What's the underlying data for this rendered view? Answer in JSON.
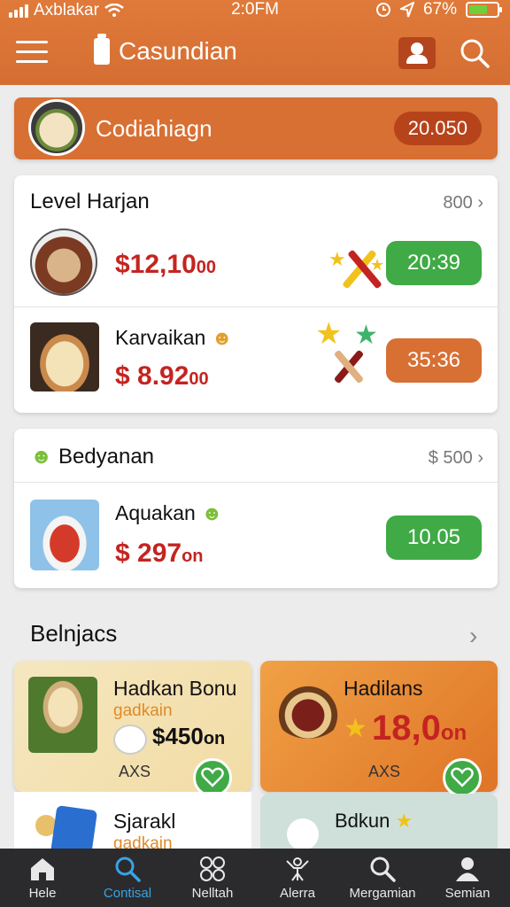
{
  "status": {
    "carrier": "Axblakar",
    "time": "2:0FM",
    "battery": "67%",
    "battery_level": 0.67
  },
  "header": {
    "title": "Casundian"
  },
  "banner": {
    "title": "Codiahiagn",
    "value": "20.050"
  },
  "card1": {
    "title": "Level Harjan",
    "more": "800",
    "items": [
      {
        "name": "",
        "price": "$12,10",
        "price_suffix": "00",
        "timer": "20:39",
        "timer_color": "#3faa46"
      },
      {
        "name": "Karvaikan",
        "price": "$ 8.92",
        "price_suffix": "00",
        "timer": "35:36",
        "timer_color": "#d86f33"
      }
    ]
  },
  "card2": {
    "title": "Bedyanan",
    "more": "$ 500",
    "items": [
      {
        "name": "Aquakan",
        "price": "$ 297",
        "price_suffix": "on",
        "timer": "10.05",
        "timer_color": "#3faa46"
      }
    ]
  },
  "section": {
    "title": "Belnjacs"
  },
  "tiles": [
    {
      "title": "Hadkan Bonu",
      "subtitle": "gadkain",
      "price": "$450",
      "price_suffix": "on",
      "tag": "AXS"
    },
    {
      "title": "Hadilans",
      "price": "18,0",
      "price_suffix": "on",
      "tag": "AXS"
    },
    {
      "title": "Sjarakl",
      "subtitle": "gadkain"
    },
    {
      "title": "Bdkun"
    }
  ],
  "nav": [
    {
      "label": "Hele",
      "icon": "home-icon"
    },
    {
      "label": "Contisal",
      "icon": "search-icon",
      "active": true
    },
    {
      "label": "Nelltah",
      "icon": "grid-icon"
    },
    {
      "label": "Alerra",
      "icon": "person-arms-icon"
    },
    {
      "label": "Mergamian",
      "icon": "search-icon"
    },
    {
      "label": "Semian",
      "icon": "user-icon"
    }
  ],
  "colors": {
    "brand": "#d86f33",
    "accent_green": "#3faa46",
    "price_red": "#c42421",
    "nav_active": "#3aa3e6"
  }
}
